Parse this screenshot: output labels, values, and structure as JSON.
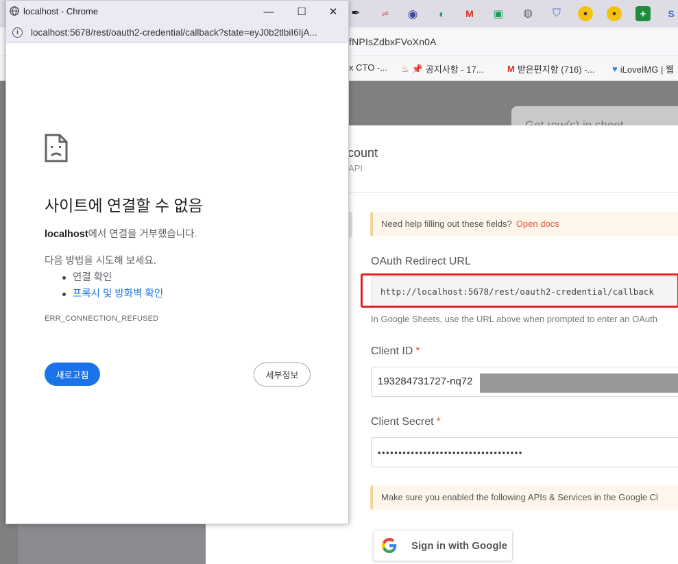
{
  "background_browser": {
    "address_text": "fNPIsZdbxFVoXn0A",
    "tab_favicons": [
      "dark-blob-icon",
      "red-link-icon",
      "chrome-icon",
      "edge-icon",
      "gmail-icon",
      "meet-icon",
      "globe-icon",
      "shield-icon",
      "minion-icon",
      "minion-icon",
      "sheets-icon",
      "s-icon"
    ],
    "bookmarks": [
      {
        "label": "x CTO -...",
        "icon": ""
      },
      {
        "label": "공지사항 - 17...",
        "icon": "pin-icon"
      },
      {
        "label": "받은편지함 (716) -...",
        "icon": "gmail-icon"
      },
      {
        "label": "iLoveIMG | 웹",
        "icon": "heart-icon"
      }
    ]
  },
  "background_page": {
    "card_peek_text": "Get row(s) in sheet",
    "modal_title": "ccount",
    "modal_subtitle": "2 API",
    "help_notice": {
      "text": "Need help filling out these fields?",
      "link": "Open docs"
    },
    "redirect_label": "OAuth Redirect URL",
    "redirect_url": "http://localhost:5678/rest/oauth2-credential/callback",
    "redirect_help": "In Google Sheets, use the URL above when prompted to enter an OAuth",
    "client_id_label": "Client ID",
    "client_id_value": "193284731727-nq72",
    "client_secret_label": "Client Secret",
    "client_secret_value": "•••••••••••••••••••••••••••••••••••",
    "apis_notice": "Make sure you enabled the following APIs & Services in the Google Cl",
    "google_button": "Sign in with Google",
    "colors": {
      "accent": "#e4573a",
      "highlight": "#e0211f",
      "notice_bg": "#fef6ea"
    }
  },
  "popup": {
    "title": "localhost - Chrome",
    "url": "localhost:5678/rest/oauth2-credential/callback?state=eyJ0b2tlbiI6IjA...",
    "controls": {
      "minimize": "—",
      "maximize": "☐",
      "close": "✕"
    },
    "error": {
      "heading": "사이트에 연결할 수 없음",
      "host": "localhost",
      "message_suffix": "에서 연결을 거부했습니다.",
      "try_heading": "다음 방법을 시도해 보세요.",
      "suggestion_1": "연결 확인",
      "suggestion_2": "프록시 및 방화벽 확인",
      "code": "ERR_CONNECTION_REFUSED",
      "reload_button": "새로고침",
      "details_button": "세부정보"
    },
    "colors": {
      "link": "#1a73e8",
      "reload_bg": "#1a73e8"
    }
  }
}
